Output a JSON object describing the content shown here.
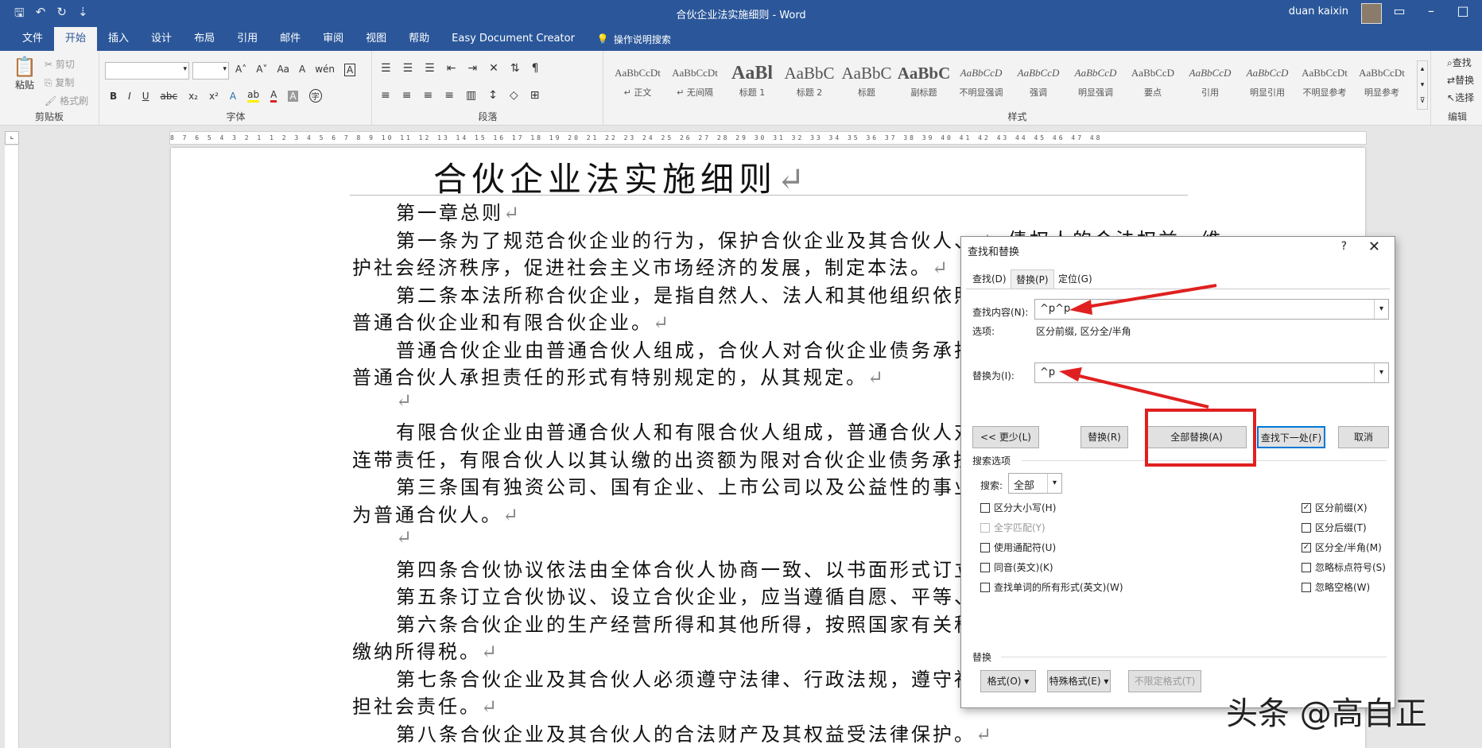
{
  "titlebar": {
    "title": "合伙企业法实施细则 - Word",
    "user": "duan kaixin",
    "qat": [
      "🖫",
      "↶",
      "↻",
      "⇣"
    ]
  },
  "menu": {
    "tabs": [
      "文件",
      "开始",
      "插入",
      "设计",
      "布局",
      "引用",
      "邮件",
      "审阅",
      "视图",
      "帮助",
      "Easy Document Creator"
    ],
    "tellme": "操作说明搜索"
  },
  "ribbon": {
    "clipboard": {
      "paste": "粘贴",
      "cut": "剪切",
      "copy": "复制",
      "format_painter": "格式刷",
      "label": "剪贴板"
    },
    "font": {
      "label": "字体",
      "bold": "B",
      "italic": "I",
      "underline": "U",
      "strike": "abc",
      "sub": "x₂",
      "sup": "x²",
      "grow": "A˄",
      "shrink": "A˅",
      "case": "Aa",
      "clear": "A",
      "char_border": "A",
      "text_effect": "A",
      "highlight": "ab",
      "font_color": "A",
      "shading": "A",
      "enclose": "字"
    },
    "paragraph": {
      "label": "段落"
    },
    "styles": {
      "label": "样式",
      "items": [
        {
          "preview": "AaBbCcDt",
          "name": "↵ 正文"
        },
        {
          "preview": "AaBbCcDt",
          "name": "↵ 无间隔"
        },
        {
          "preview": "AaBl",
          "name": "标题 1"
        },
        {
          "preview": "AaBbC",
          "name": "标题 2"
        },
        {
          "preview": "AaBbC",
          "name": "标题"
        },
        {
          "preview": "AaBbC",
          "name": "副标题"
        },
        {
          "preview": "AaBbCcD",
          "name": "不明显强调"
        },
        {
          "preview": "AaBbCcD",
          "name": "强调"
        },
        {
          "preview": "AaBbCcD",
          "name": "明显强调"
        },
        {
          "preview": "AaBbCcD",
          "name": "要点"
        },
        {
          "preview": "AaBbCcD",
          "name": "引用"
        },
        {
          "preview": "AaBbCcD",
          "name": "明显引用"
        },
        {
          "preview": "AaBbCcDt",
          "name": "不明显参考"
        },
        {
          "preview": "AaBbCcDt",
          "name": "明显参考"
        }
      ]
    },
    "editing": {
      "find": "查找",
      "replace": "替换",
      "select": "选择",
      "label": "编辑"
    }
  },
  "ruler": {
    "ticks": "8  7  6  5  4  3  2  1     1  2  3  4  5  6  7  8  9  10  11  12  13  14  15  16  17  18  19  20  21  22  23  24  25  26  27  28  29  30  31  32  33  34  35  36  37  38  39  40  41  42  43  44  45  46  47  48"
  },
  "document": {
    "heading": "合伙企业法实施细则",
    "pilcrow": "↵",
    "lines": [
      {
        "text": "第一章总则",
        "indent": true
      },
      {
        "text": "第一条为了规范合伙企业的行为，保护合伙企业及其合伙人、",
        "indent": true
      },
      {
        "text": "护社会经济秩序，促进社会主义市场经济的发展，制定本法。",
        "indent": false
      },
      {
        "text": "第二条本法所称合伙企业，是指自然人、法人和其他组织依照",
        "indent": true
      },
      {
        "text": "普通合伙企业和有限合伙企业。",
        "indent": false
      },
      {
        "text": "普通合伙企业由普通合伙人组成，合伙人对合伙企业债务承担",
        "indent": true
      },
      {
        "text": "普通合伙人承担责任的形式有特别规定的，从其规定。",
        "indent": false
      },
      {
        "text": "",
        "indent": true
      },
      {
        "text": "有限合伙企业由普通合伙人和有限合伙人组成，普通合伙人对",
        "indent": true
      },
      {
        "text": "连带责任，有限合伙人以其认缴的出资额为限对合伙企业债务承担",
        "indent": false
      },
      {
        "text": "第三条国有独资公司、国有企业、上市公司以及公益性的事业",
        "indent": true
      },
      {
        "text": "为普通合伙人。",
        "indent": false
      },
      {
        "text": "",
        "indent": true
      },
      {
        "text": "第四条合伙协议依法由全体合伙人协商一致、以书面形式订立",
        "indent": true
      },
      {
        "text": "第五条订立合伙协议、设立合伙企业，应当遵循自愿、平等、",
        "indent": true
      },
      {
        "text": "第六条合伙企业的生产经营所得和其他所得，按照国家有关税",
        "indent": true
      },
      {
        "text": "缴纳所得税。",
        "indent": false
      },
      {
        "text": "第七条合伙企业及其合伙人必须遵守法律、行政法规，遵守社",
        "indent": true
      },
      {
        "text": "担社会责任。",
        "indent": false
      },
      {
        "text": "第八条合伙企业及其合伙人的合法财产及其权益受法律保护。",
        "indent": true
      }
    ],
    "behind_dialog": "债权人的合法权益，维"
  },
  "dialog": {
    "title": "查找和替换",
    "help": "?",
    "close": "✕",
    "tabs": [
      "查找(D)",
      "替换(P)",
      "定位(G)"
    ],
    "find_label": "查找内容(N):",
    "find_value": "^p^p",
    "options_label": "选项:",
    "options_value": "区分前缀, 区分全/半角",
    "replace_label": "替换为(I):",
    "replace_value": "^p",
    "buttons": {
      "less": "<< 更少(L)",
      "replace": "替换(R)",
      "replace_all": "全部替换(A)",
      "find_next": "查找下一处(F)",
      "cancel": "取消"
    },
    "search_options_label": "搜索选项",
    "search_label": "搜索:",
    "search_value": "全部",
    "left_checks": [
      {
        "label": "区分大小写(H)",
        "checked": false,
        "disabled": false
      },
      {
        "label": "全字匹配(Y)",
        "checked": false,
        "disabled": true
      },
      {
        "label": "使用通配符(U)",
        "checked": false,
        "disabled": false
      },
      {
        "label": "同音(英文)(K)",
        "checked": false,
        "disabled": false
      },
      {
        "label": "查找单词的所有形式(英文)(W)",
        "checked": false,
        "disabled": false
      }
    ],
    "right_checks": [
      {
        "label": "区分前缀(X)",
        "checked": true
      },
      {
        "label": "区分后缀(T)",
        "checked": false
      },
      {
        "label": "区分全/半角(M)",
        "checked": true
      },
      {
        "label": "忽略标点符号(S)",
        "checked": false
      },
      {
        "label": "忽略空格(W)",
        "checked": false
      }
    ],
    "replace_section_label": "替换",
    "format_buttons": {
      "format": "格式(O) ▾",
      "special": "特殊格式(E) ▾",
      "no_format": "不限定格式(T)"
    }
  },
  "watermark": "头条 @高自正",
  "colors": {
    "brand": "#2b579a",
    "annotation": "#e02020"
  }
}
